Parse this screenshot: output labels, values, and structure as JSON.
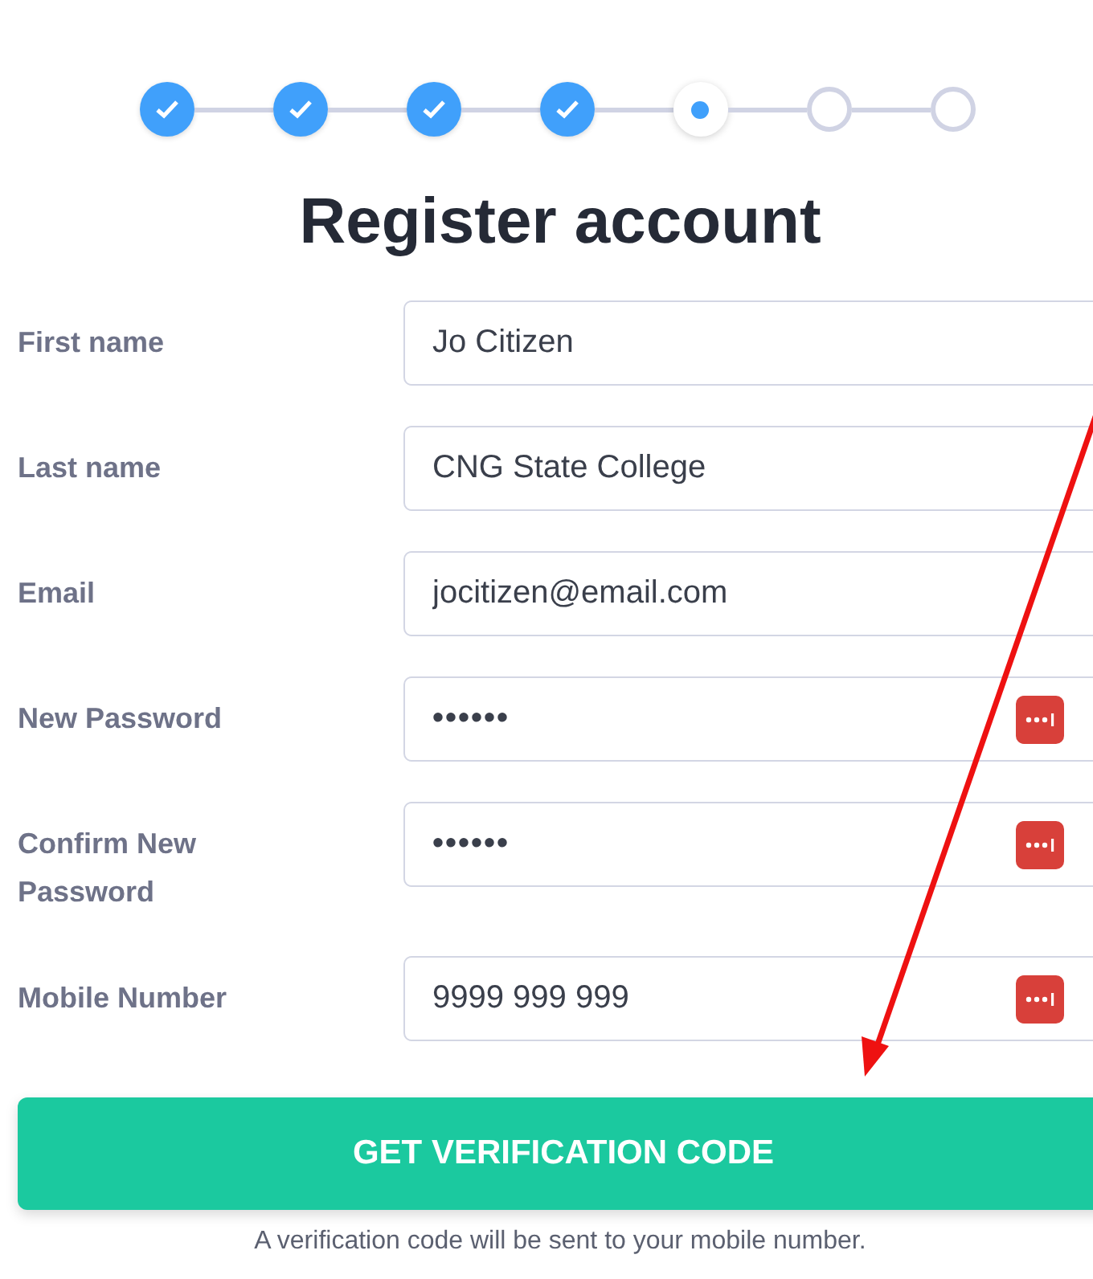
{
  "steps": [
    {
      "kind": "done"
    },
    {
      "kind": "done"
    },
    {
      "kind": "done"
    },
    {
      "kind": "done"
    },
    {
      "kind": "current"
    },
    {
      "kind": "todo"
    },
    {
      "kind": "todo"
    }
  ],
  "title": "Register account",
  "fields": [
    {
      "label": "First name",
      "value": "Jo Citizen",
      "kind": "text",
      "manager_icon": false
    },
    {
      "label": "Last name",
      "value": "CNG State College",
      "kind": "text",
      "manager_icon": false
    },
    {
      "label": "Email",
      "value": "jocitizen@email.com",
      "kind": "text",
      "manager_icon": false
    },
    {
      "label": "New Password",
      "value": "••••••",
      "kind": "password",
      "manager_icon": true
    },
    {
      "label": "Confirm New Password",
      "value": "••••••",
      "kind": "password",
      "manager_icon": true
    },
    {
      "label": "Mobile Number",
      "value": "9999 999 999",
      "kind": "text",
      "manager_icon": true
    }
  ],
  "submit": {
    "label": "GET VERIFICATION CODE"
  },
  "helper_text": "A verification code will be sent to your mobile number."
}
